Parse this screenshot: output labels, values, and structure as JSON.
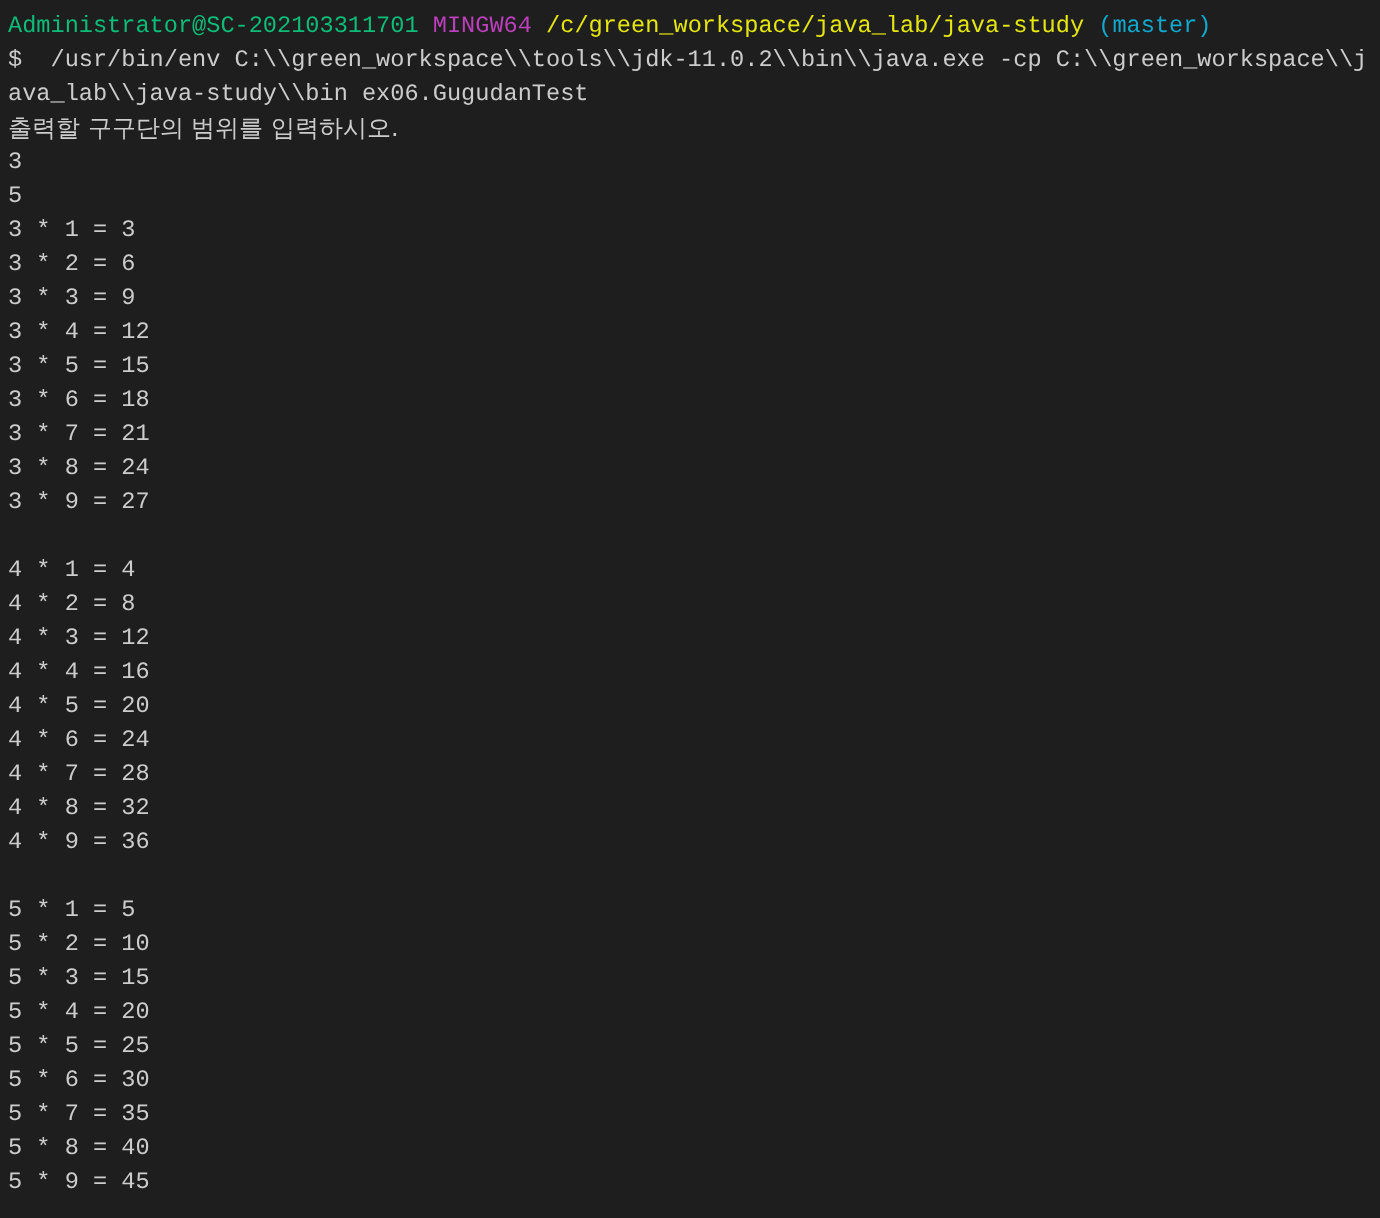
{
  "prompt": {
    "user_host": "Administrator@SC-202103311701",
    "system": "MINGW64",
    "path": "/c/green_workspace/java_lab/java-study",
    "branch": "(master)"
  },
  "command_lines": [
    "$  /usr/bin/env C:\\\\green_workspace\\\\tools\\\\jdk-11.0.2\\\\bin\\\\java.exe -cp C:\\\\green_workspace\\\\j",
    "ava_lab\\\\java-study\\\\bin ex06.GugudanTest"
  ],
  "output_blocks": [
    [
      "출력할 구구단의 범위를 입력하시오.",
      "3",
      "5",
      "3 * 1 = 3",
      "3 * 2 = 6",
      "3 * 3 = 9",
      "3 * 4 = 12",
      "3 * 5 = 15",
      "3 * 6 = 18",
      "3 * 7 = 21",
      "3 * 8 = 24",
      "3 * 9 = 27"
    ],
    [
      "4 * 1 = 4",
      "4 * 2 = 8",
      "4 * 3 = 12",
      "4 * 4 = 16",
      "4 * 5 = 20",
      "4 * 6 = 24",
      "4 * 7 = 28",
      "4 * 8 = 32",
      "4 * 9 = 36"
    ],
    [
      "5 * 1 = 5",
      "5 * 2 = 10",
      "5 * 3 = 15",
      "5 * 4 = 20",
      "5 * 5 = 25",
      "5 * 6 = 30",
      "5 * 7 = 35",
      "5 * 8 = 40",
      "5 * 9 = 45"
    ]
  ]
}
